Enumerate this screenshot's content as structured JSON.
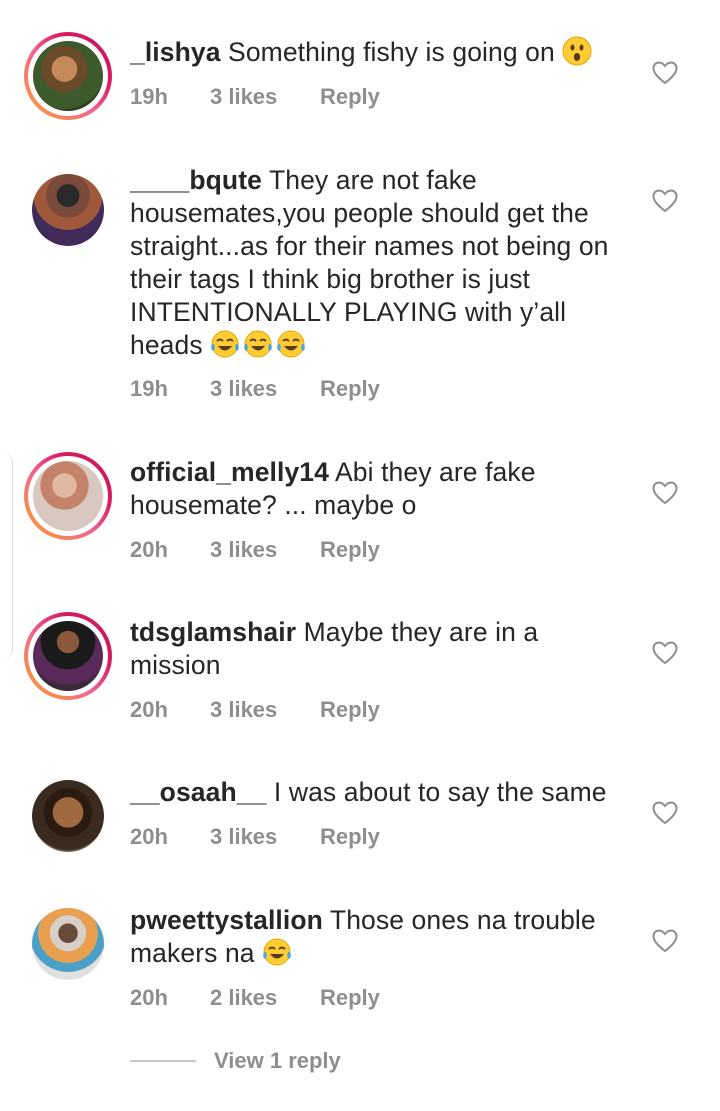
{
  "comments": [
    {
      "username": "_lishya",
      "text": "Something fishy is going on",
      "emojis": [
        "hushed-face"
      ],
      "time": "19h",
      "likes": "3 likes",
      "reply": "Reply",
      "has_story_ring": true
    },
    {
      "username": "____bqute",
      "text": "They are not fake housemates,you people should get the straight...as for their names not being on their tags I think big brother is just INTENTIONALLY PLAYING with y’all heads",
      "emojis": [
        "tears-of-joy",
        "tears-of-joy",
        "tears-of-joy"
      ],
      "time": "19h",
      "likes": "3 likes",
      "reply": "Reply",
      "has_story_ring": false
    },
    {
      "username": "official_melly14",
      "text": "Abi they are fake housemate? ... maybe o",
      "emojis": [],
      "time": "20h",
      "likes": "3 likes",
      "reply": "Reply",
      "has_story_ring": true
    },
    {
      "username": "tdsglamshair",
      "text": "Maybe they are in a mission",
      "emojis": [],
      "time": "20h",
      "likes": "3 likes",
      "reply": "Reply",
      "has_story_ring": true
    },
    {
      "username": "__osaah__",
      "text": "I was about to say the same",
      "emojis": [],
      "time": "20h",
      "likes": "3 likes",
      "reply": "Reply",
      "has_story_ring": false
    },
    {
      "username": "pweettystallion",
      "text": "Those ones na trouble makers na",
      "emojis": [
        "tears-of-joy"
      ],
      "time": "20h",
      "likes": "2 likes",
      "reply": "Reply",
      "has_story_ring": false
    }
  ],
  "view_replies_label": "View 1 reply",
  "icons": {
    "like": "heart-outline-icon",
    "hushed": "hushed-face-emoji",
    "laugh": "face-with-tears-of-joy-emoji"
  },
  "colors": {
    "text": "#262626",
    "meta": "#8e8e8e",
    "ring_start": "#f9a825",
    "ring_end": "#c2185b"
  }
}
